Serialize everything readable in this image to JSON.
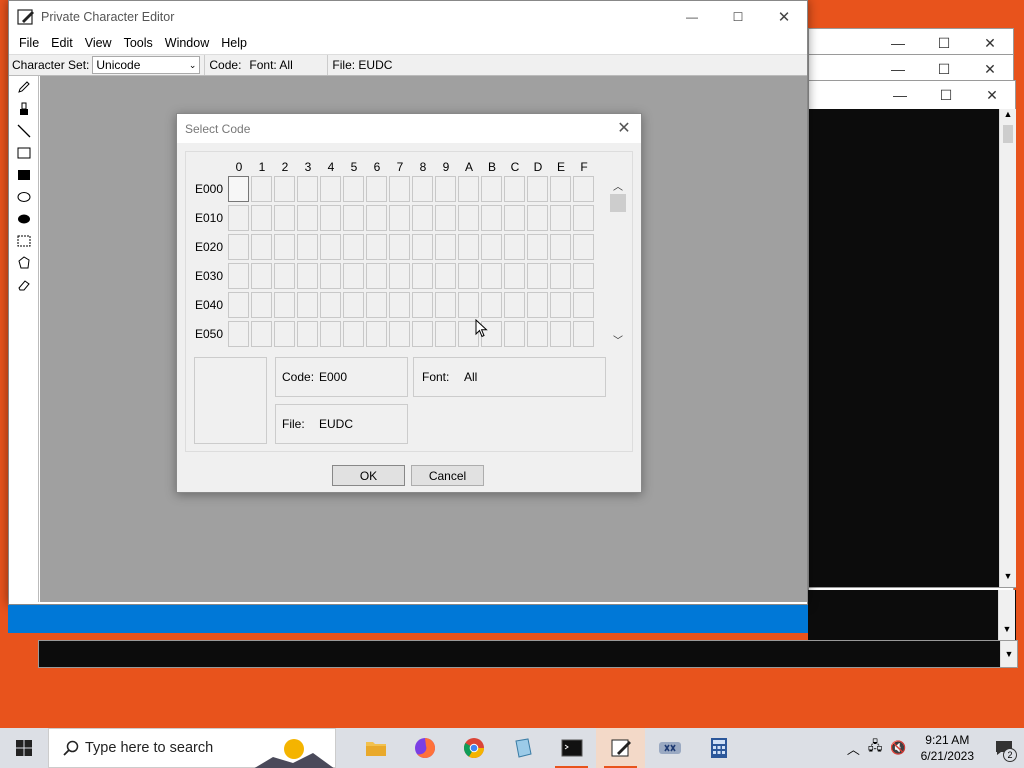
{
  "main_window": {
    "title": "Private Character Editor",
    "menu": [
      "File",
      "Edit",
      "View",
      "Tools",
      "Window",
      "Help"
    ],
    "toolbar": {
      "charset_label": "Character Set:",
      "charset_value": "Unicode",
      "code_label": "Code:",
      "font_info": "Font: All",
      "file_info": "File: EUDC"
    },
    "tools": [
      "pencil-icon",
      "brush-icon",
      "line-icon",
      "hollow-rectangle-icon",
      "filled-rectangle-icon",
      "hollow-ellipse-icon",
      "filled-ellipse-icon",
      "rectangular-selection-icon",
      "freeform-selection-icon",
      "eraser-icon"
    ]
  },
  "dialog": {
    "title": "Select Code",
    "columns": [
      "0",
      "1",
      "2",
      "3",
      "4",
      "5",
      "6",
      "7",
      "8",
      "9",
      "A",
      "B",
      "C",
      "D",
      "E",
      "F"
    ],
    "rows": [
      "E000",
      "E010",
      "E020",
      "E030",
      "E040",
      "E050"
    ],
    "code_label": "Code:",
    "code_value": "E000",
    "font_label": "Font:",
    "font_value": "All",
    "file_label": "File:",
    "file_value": "EUDC",
    "ok_label": "OK",
    "cancel_label": "Cancel"
  },
  "taskbar": {
    "search_placeholder": "Type here to search",
    "time": "9:21 AM",
    "date": "6/21/2023",
    "notification_count": "2",
    "apps": [
      "file-explorer-icon",
      "firefox-icon",
      "chrome-icon",
      "notepad-icon",
      "terminal-icon",
      "private-character-editor-icon",
      "network-app-icon",
      "calculator-icon"
    ]
  },
  "colors": {
    "desktop": "#e8531c",
    "accent_blue": "#0078d7",
    "canvas_gray": "#a0a0a0",
    "dialog_bg": "#f0f0f0"
  }
}
